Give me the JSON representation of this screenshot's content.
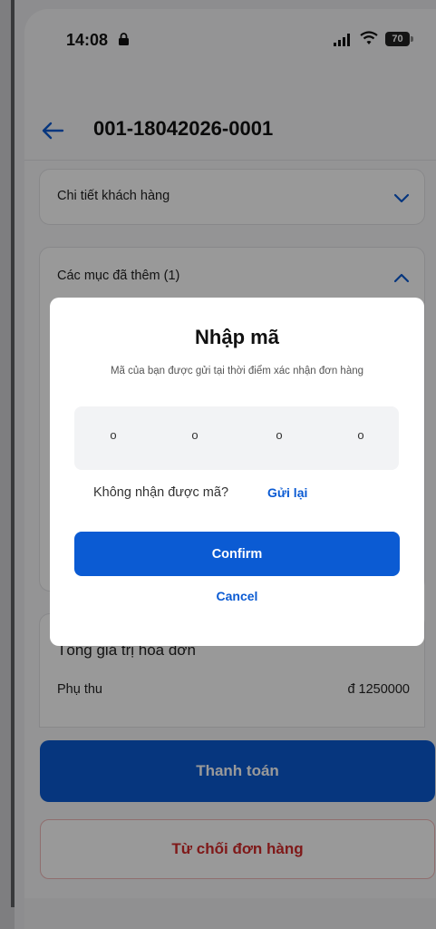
{
  "status_bar": {
    "time": "14:08",
    "battery_level": "70"
  },
  "header": {
    "title": "001-18042026-0001"
  },
  "sections": {
    "customer_details_label": "Chi tiết khách hàng",
    "added_items_label": "Các mục đã thêm (1)",
    "invoice_total_label": "Tổng giá trị hóa đơn",
    "surcharge_label": "Phụ thu",
    "surcharge_value": "đ 1250000"
  },
  "actions": {
    "pay_label": "Thanh toán",
    "reject_label": "Từ chối đơn hàng"
  },
  "modal": {
    "title": "Nhập mã",
    "subtitle": "Mã của bạn được gửi tại thời điểm xác nhận đơn hàng",
    "otp_digits": [
      "o",
      "o",
      "o",
      "o"
    ],
    "resend_prompt": "Không nhận được mã?",
    "resend_link": "Gửi lại",
    "confirm_label": "Confirm",
    "cancel_label": "Cancel"
  },
  "colors": {
    "primary": "#0b5bd3",
    "danger": "#d42a2a",
    "overlay": "rgba(0,0,0,0.40)"
  }
}
